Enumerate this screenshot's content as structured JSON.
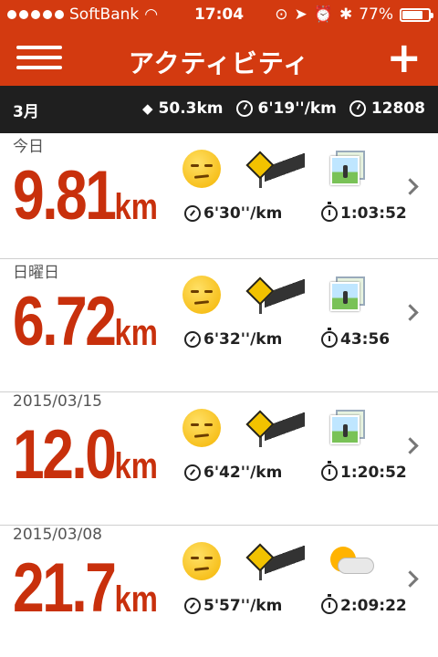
{
  "status": {
    "carrier": "SoftBank",
    "time": "17:04",
    "battery": "77%",
    "battery_level": 0.77
  },
  "nav": {
    "title": "アクティビティ",
    "add_label": "+"
  },
  "summary": {
    "month": "3月",
    "distance": "50.3km",
    "pace": "6'19''/km",
    "calories": "12808"
  },
  "activities": [
    {
      "date": "今日",
      "distance": "9.81",
      "unit": "km",
      "pace": "6'30''/km",
      "duration": "1:03:52",
      "mood": "meh-face",
      "route": "road-icon",
      "media": "photo"
    },
    {
      "date": "日曜日",
      "distance": "6.72",
      "unit": "km",
      "pace": "6'32''/km",
      "duration": "43:56",
      "mood": "meh-face",
      "route": "road-icon",
      "media": "photo"
    },
    {
      "date": "2015/03/15",
      "distance": "12.0",
      "unit": "km",
      "pace": "6'42''/km",
      "duration": "1:20:52",
      "mood": "meh-face",
      "route": "road-icon",
      "media": "photo"
    },
    {
      "date": "2015/03/08",
      "distance": "21.7",
      "unit": "km",
      "pace": "5'57''/km",
      "duration": "2:09:22",
      "mood": "meh-face",
      "route": "road-icon",
      "media": "weather"
    }
  ]
}
